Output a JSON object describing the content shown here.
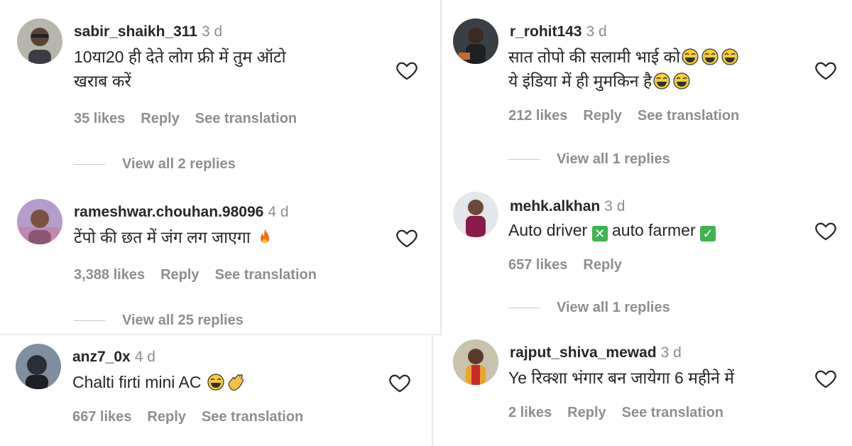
{
  "comments": [
    {
      "username": "sabir_shaikh_311",
      "time": "3 d",
      "text1": "10या20 ही देते लोग फ्री में तुम ऑटो",
      "text2": "खराब करें",
      "likes": "35 likes",
      "reply": "Reply",
      "translation": "See translation",
      "view_replies": "View all 2 replies"
    },
    {
      "username": "rameshwar.chouhan.98096",
      "time": "4 d",
      "text1": "टेंपो की छत में जंग लग जाएगा",
      "likes": "3,388 likes",
      "reply": "Reply",
      "translation": "See translation",
      "view_replies": "View all 25 replies"
    },
    {
      "username": "anz7_0x",
      "time": "4 d",
      "text1": "Chalti firti mini AC",
      "likes": "667 likes",
      "reply": "Reply",
      "translation": "See translation"
    },
    {
      "username": "r_rohit143",
      "time": "3 d",
      "text1": "सात तोपो की सलामी भाई को",
      "text2": "ये इंडिया में ही मुमकिन है",
      "likes": "212 likes",
      "reply": "Reply",
      "translation": "See translation",
      "view_replies": "View all 1 replies"
    },
    {
      "username": "mehk.alkhan",
      "time": "3 d",
      "text_a": "Auto driver",
      "text_b": "auto farmer",
      "likes": "657 likes",
      "reply": "Reply",
      "view_replies": "View all 1 replies"
    },
    {
      "username": "rajput_shiva_mewad",
      "time": "3 d",
      "text1": "Ye रिक्शा भंगार बन जायेगा 6 महीने में",
      "likes": "2 likes",
      "reply": "Reply",
      "translation": "See translation"
    }
  ],
  "icons": {
    "heart": "heart-outline-icon",
    "laugh": "face-with-tears-of-joy-icon",
    "fire": "fire-icon",
    "clap": "clapping-hands-icon",
    "cross": "cross-mark-box-icon",
    "check": "check-mark-box-icon"
  },
  "colors": {
    "username": "#262626",
    "secondary": "#8e8e8e",
    "cross_box": "#3fb34f",
    "check_box": "#3fb34f"
  },
  "box_marks": {
    "cross": "✕",
    "check": "✓"
  }
}
